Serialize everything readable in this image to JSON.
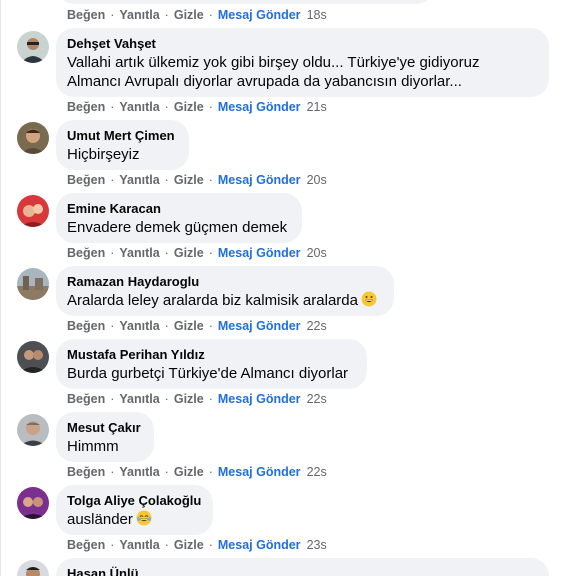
{
  "actions": {
    "like": "Beğen",
    "reply": "Yanıtla",
    "hide": "Gizle",
    "send_message": "Mesaj Gönder",
    "separator": "·"
  },
  "first_row_time": "18s",
  "comments": [
    {
      "author": "Dehşet Vahşet",
      "lines": [
        "Vallahi artık ülkemiz yok gibi birşey oldu... Türkiye'ye gidiyoruz",
        "Almancı Avrupalı diyorlar avrupada da yabancısın diyorlar..."
      ],
      "time": "21s"
    },
    {
      "author": "Umut Mert Çimen",
      "lines": [
        "Hiçbirşeyiz"
      ],
      "time": "20s"
    },
    {
      "author": "Emine Karacan",
      "lines": [
        "Envadere demek güçmen demek"
      ],
      "time": "20s"
    },
    {
      "author": "Ramazan Haydaroglu",
      "lines": [
        "Aralarda leley aralarda biz kalmisik aralarda"
      ],
      "emoji": "grinning-face-emoji",
      "time": "22s"
    },
    {
      "author": "Mustafa Perihan Yıldız",
      "lines": [
        "Burda gurbetçi Türkiye'de Almancı diyorlar"
      ],
      "time": "22s"
    },
    {
      "author": "Mesut Çakır",
      "lines": [
        "Himmm"
      ],
      "time": "22s"
    },
    {
      "author": "Tolga Aliye Çolakoğlu",
      "lines": [
        "ausländer"
      ],
      "emoji": "tears-of-joy-emoji",
      "time": "23s"
    },
    {
      "author": "Hasan Ünlü",
      "lines": []
    }
  ],
  "colors": {
    "bubble": "#f0f2f5",
    "action_gray": "#65676b",
    "link_blue": "#216fdb",
    "text": "#050505"
  }
}
